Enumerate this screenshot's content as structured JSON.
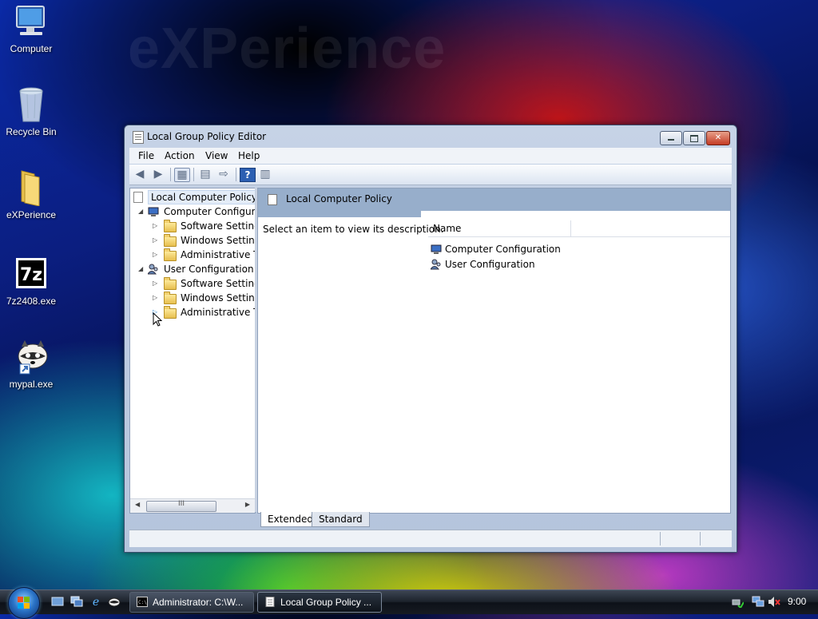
{
  "desktop": {
    "watermark": "eXPerience",
    "icons": [
      {
        "label": "Computer",
        "icon": "computer-icon"
      },
      {
        "label": "Recycle Bin",
        "icon": "recycle-bin-icon"
      },
      {
        "label": "eXPerience",
        "icon": "folder-icon"
      },
      {
        "label": "7z2408.exe",
        "icon": "7zip-icon"
      },
      {
        "label": "mypal.exe",
        "icon": "raccoon-icon"
      }
    ]
  },
  "window": {
    "title": "Local Group Policy Editor",
    "menu": [
      "File",
      "Action",
      "View",
      "Help"
    ],
    "tree": {
      "root": "Local Computer Policy",
      "items": [
        {
          "label": "Computer Configura",
          "level": 1,
          "expanded": true
        },
        {
          "label": "Software Settings",
          "level": 2
        },
        {
          "label": "Windows Setting",
          "level": 2
        },
        {
          "label": "Administrative Te",
          "level": 2
        },
        {
          "label": "User Configuration",
          "level": 1,
          "expanded": true
        },
        {
          "label": "Software Settings",
          "level": 2
        },
        {
          "label": "Windows Setting",
          "level": 2
        },
        {
          "label": "Administrative Te",
          "level": 2
        }
      ],
      "scroll_thumb_glyph": "III"
    },
    "details": {
      "header": "Local Computer Policy",
      "description": "Select an item to view its description.",
      "column_name": "Name",
      "items": [
        "Computer Configuration",
        "User Configuration"
      ]
    },
    "tabs": {
      "extended": "Extended",
      "standard": "Standard"
    }
  },
  "taskbar": {
    "buttons": [
      {
        "label": "Administrator: C:\\W...",
        "icon": "cmd-icon",
        "active": false
      },
      {
        "label": "Local Group Policy ...",
        "icon": "policy-icon",
        "active": true
      }
    ],
    "clock": "9:00"
  },
  "colors": {
    "window_frame": "#c6d3e6",
    "details_header": "#97aecb",
    "close_button": "#c43a24"
  }
}
